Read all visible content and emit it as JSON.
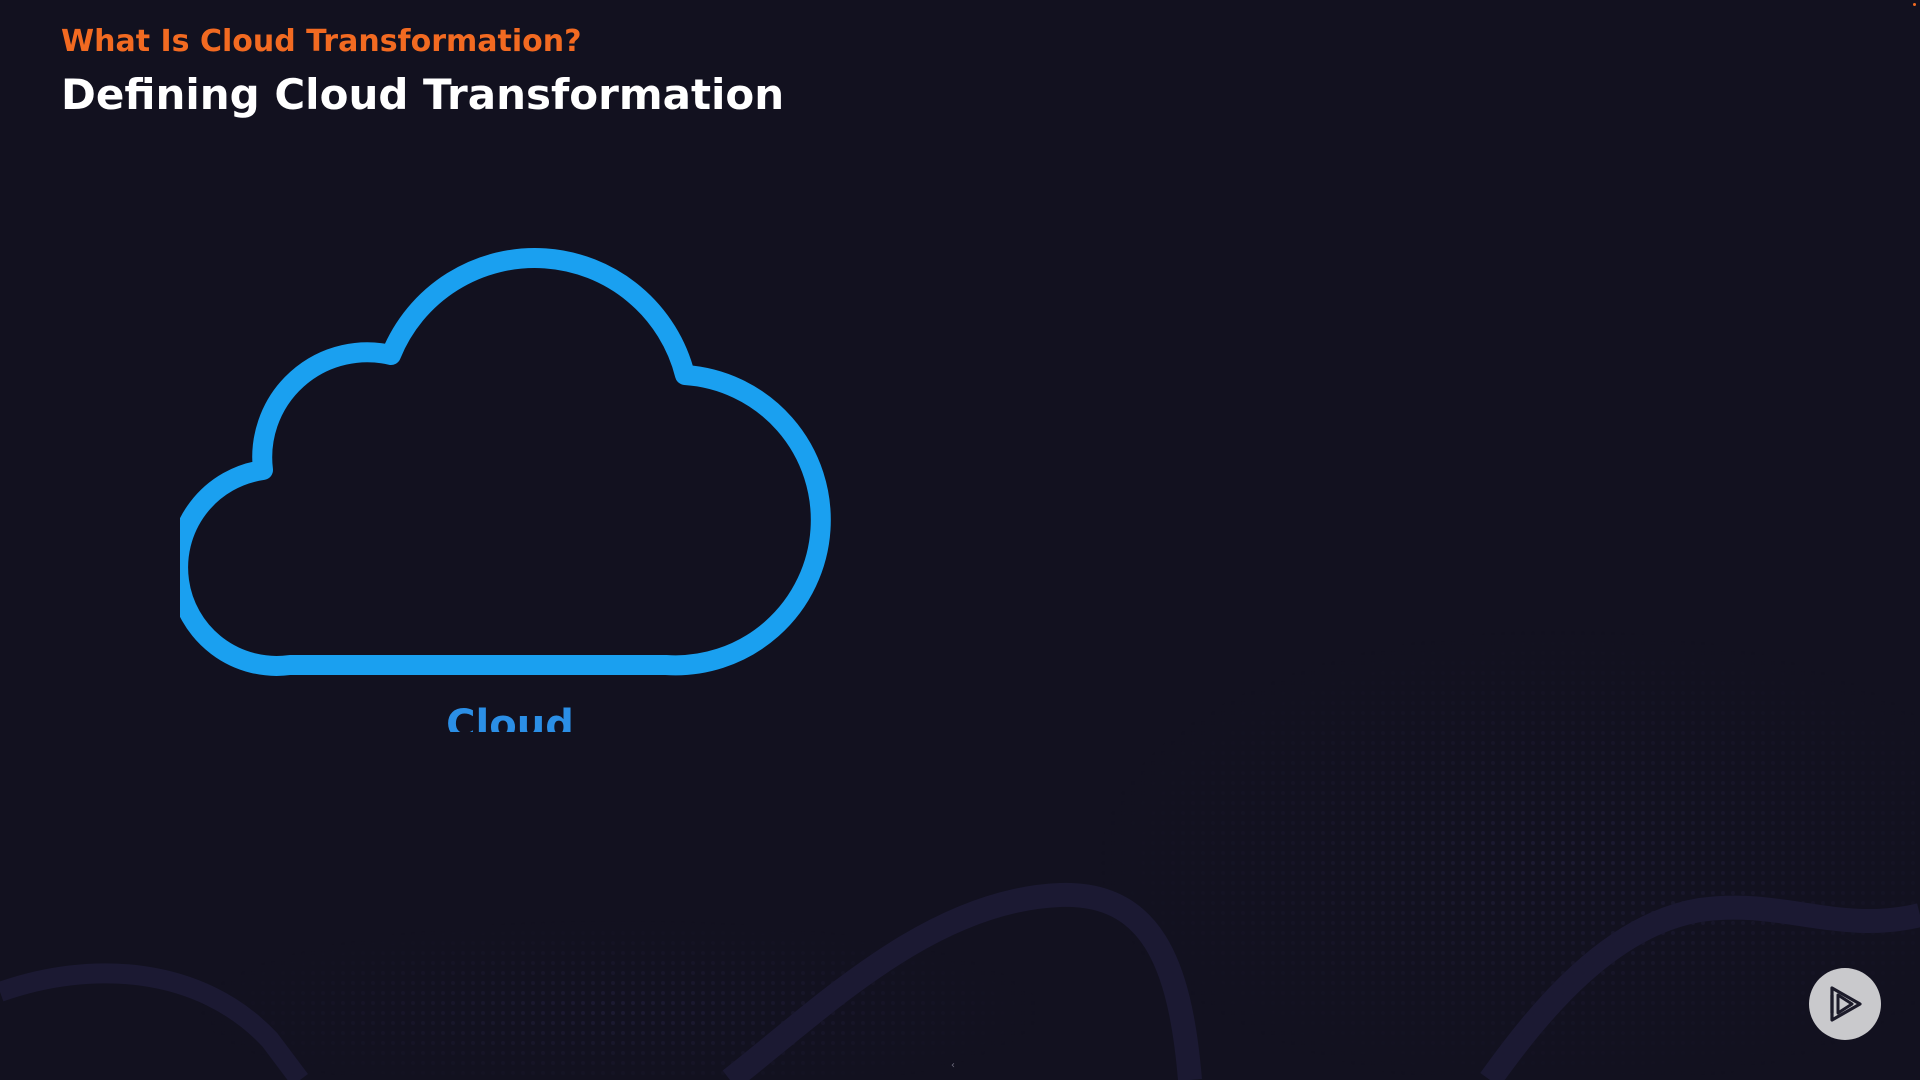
{
  "slide": {
    "eyebrow": "What Is Cloud Transformation?",
    "title": "Defining Cloud Transformation"
  },
  "cloud": {
    "icon": "cloud-outline-icon",
    "label": "Cloud",
    "color": "#1aa0f0"
  },
  "player": {
    "play_icon": "play-logo-icon"
  },
  "colors": {
    "background": "#12111f",
    "accent": "#f26a21",
    "cloud": "#1aa0f0",
    "label": "#2b8fe6",
    "button": "#c9c9cc"
  }
}
